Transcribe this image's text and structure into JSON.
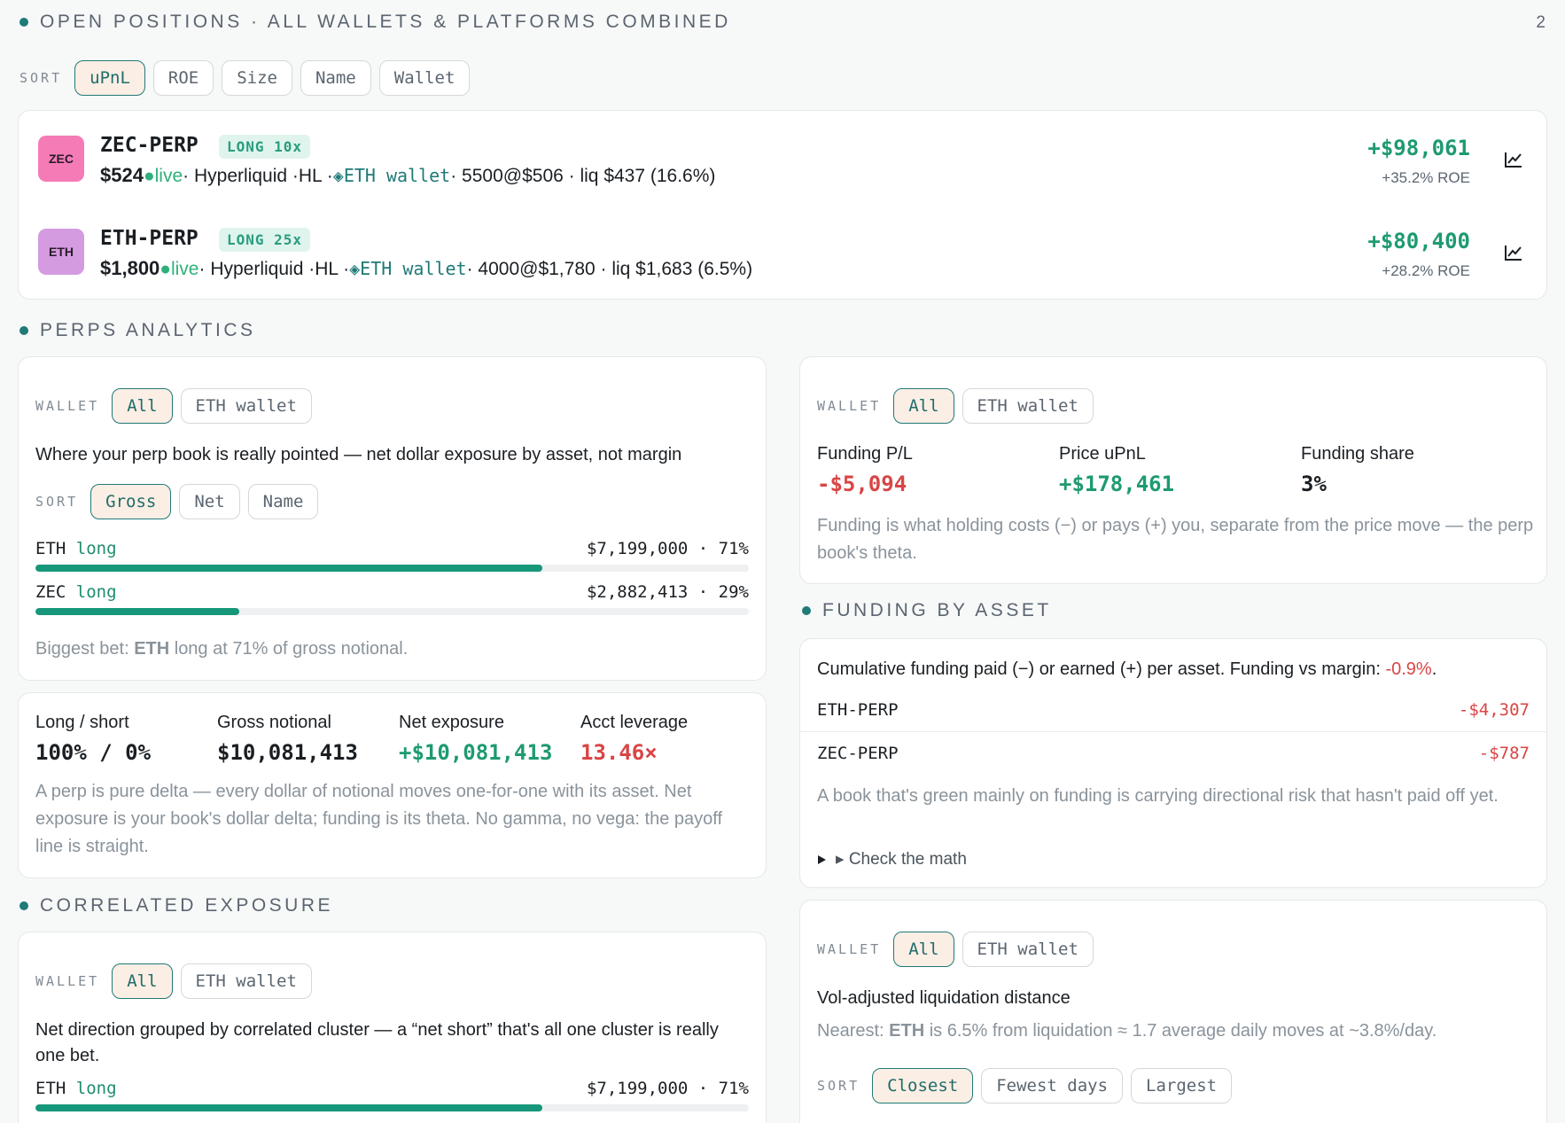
{
  "open_positions": {
    "title": "OPEN POSITIONS · ALL WALLETS & PLATFORMS COMBINED",
    "count": "2",
    "sort_label": "SORT",
    "sort_options": [
      "uPnL",
      "ROE",
      "Size",
      "Name",
      "Wallet"
    ],
    "positions": [
      {
        "icon_text": "ZEC",
        "icon_color": "#f57bb6",
        "symbol": "ZEC-PERP",
        "badge": "LONG 10x",
        "price": "$524",
        "live": "●live",
        "platform": " · Hyperliquid ·HL · ",
        "wallet_icon": "◈",
        "wallet": " ETH wallet",
        "details": " · 5500@$506 · liq $437 (16.6%)",
        "upnl": "+$98,061",
        "roe": "+35.2% ROE"
      },
      {
        "icon_text": "ETH",
        "icon_color": "#d49be0",
        "symbol": "ETH-PERP",
        "badge": "LONG 25x",
        "price": "$1,800",
        "live": "●live",
        "platform": " · Hyperliquid ·HL · ",
        "wallet_icon": "◈",
        "wallet": " ETH wallet",
        "details": " · 4000@$1,780 · liq $1,683 (6.5%)",
        "upnl": "+$80,400",
        "roe": "+28.2% ROE"
      }
    ]
  },
  "perps_analytics": {
    "title": "PERPS ANALYTICS",
    "exposure": {
      "wallet_label": "WALLET",
      "wallet_options": [
        "All",
        "ETH wallet"
      ],
      "description": "Where your perp book is really pointed — net dollar exposure by asset, not margin",
      "sort_label": "SORT",
      "sort_options": [
        "Gross",
        "Net",
        "Name"
      ],
      "rows": [
        {
          "asset": "ETH",
          "dir": "long",
          "value": "$7,199,000 · 71%",
          "share": 0.71
        },
        {
          "asset": "ZEC",
          "dir": "long",
          "value": "$2,882,413 · 29%",
          "share": 0.286
        }
      ],
      "footer_pre": "Biggest bet: ",
      "footer_bold": "ETH",
      "footer_post": " long at 71% of gross notional."
    },
    "summary": {
      "long_short_label": "Long / short",
      "long_short_value": "100% / 0%",
      "gross_label": "Gross notional",
      "gross_value": "$10,081,413",
      "net_label": "Net exposure",
      "net_value": "+$10,081,413",
      "leverage_label": "Acct leverage",
      "leverage_value": "13.46×",
      "note": "A perp is pure delta — every dollar of notional moves one-for-one with its asset. Net exposure is your book's dollar delta; funding is its theta. No gamma, no vega: the payoff line is straight."
    },
    "funding_summary": {
      "wallet_label": "WALLET",
      "wallet_options": [
        "All",
        "ETH wallet"
      ],
      "funding_pl_label": "Funding P/L",
      "funding_pl_value": "-$5,094",
      "price_upnl_label": "Price uPnL",
      "price_upnl_value": "+$178,461",
      "funding_share_label": "Funding share",
      "funding_share_value": "3%",
      "note": "Funding is what holding costs (−) or pays (+) you, separate from the price move — the perp book's theta."
    }
  },
  "funding_by_asset": {
    "title": "FUNDING BY ASSET",
    "description_pre": "Cumulative funding paid (−) or earned (+) per asset. Funding vs margin: ",
    "description_value": "-0.9%",
    "description_post": ".",
    "rows": [
      {
        "symbol": "ETH-PERP",
        "value": "-$4,307"
      },
      {
        "symbol": "ZEC-PERP",
        "value": "-$787"
      }
    ],
    "note": "A book that's green mainly on funding is carrying directional risk that hasn't paid off yet.",
    "disclosure": "▸ Check the math"
  },
  "correlated_exposure": {
    "title": "CORRELATED EXPOSURE",
    "wallet_label": "WALLET",
    "wallet_options": [
      "All",
      "ETH wallet"
    ],
    "description": "Net direction grouped by correlated cluster — a “net short” that's all one cluster is really one bet.",
    "rows": [
      {
        "asset": "ETH",
        "dir": "long",
        "value": "$7,199,000 · 71%",
        "share": 0.71
      }
    ]
  },
  "liquidation": {
    "wallet_label": "WALLET",
    "wallet_options": [
      "All",
      "ETH wallet"
    ],
    "title": "Vol-adjusted liquidation distance",
    "nearest_pre": "Nearest: ",
    "nearest_bold": "ETH",
    "nearest_post": " is 6.5% from liquidation ≈ 1.7 average daily moves at ~3.8%/day.",
    "sort_label": "SORT",
    "sort_options": [
      "Closest",
      "Fewest days",
      "Largest"
    ]
  },
  "colors": {
    "accent": "#1f7a78",
    "positive": "#1e9a72",
    "negative": "#d94545",
    "bar": "#17977a"
  }
}
